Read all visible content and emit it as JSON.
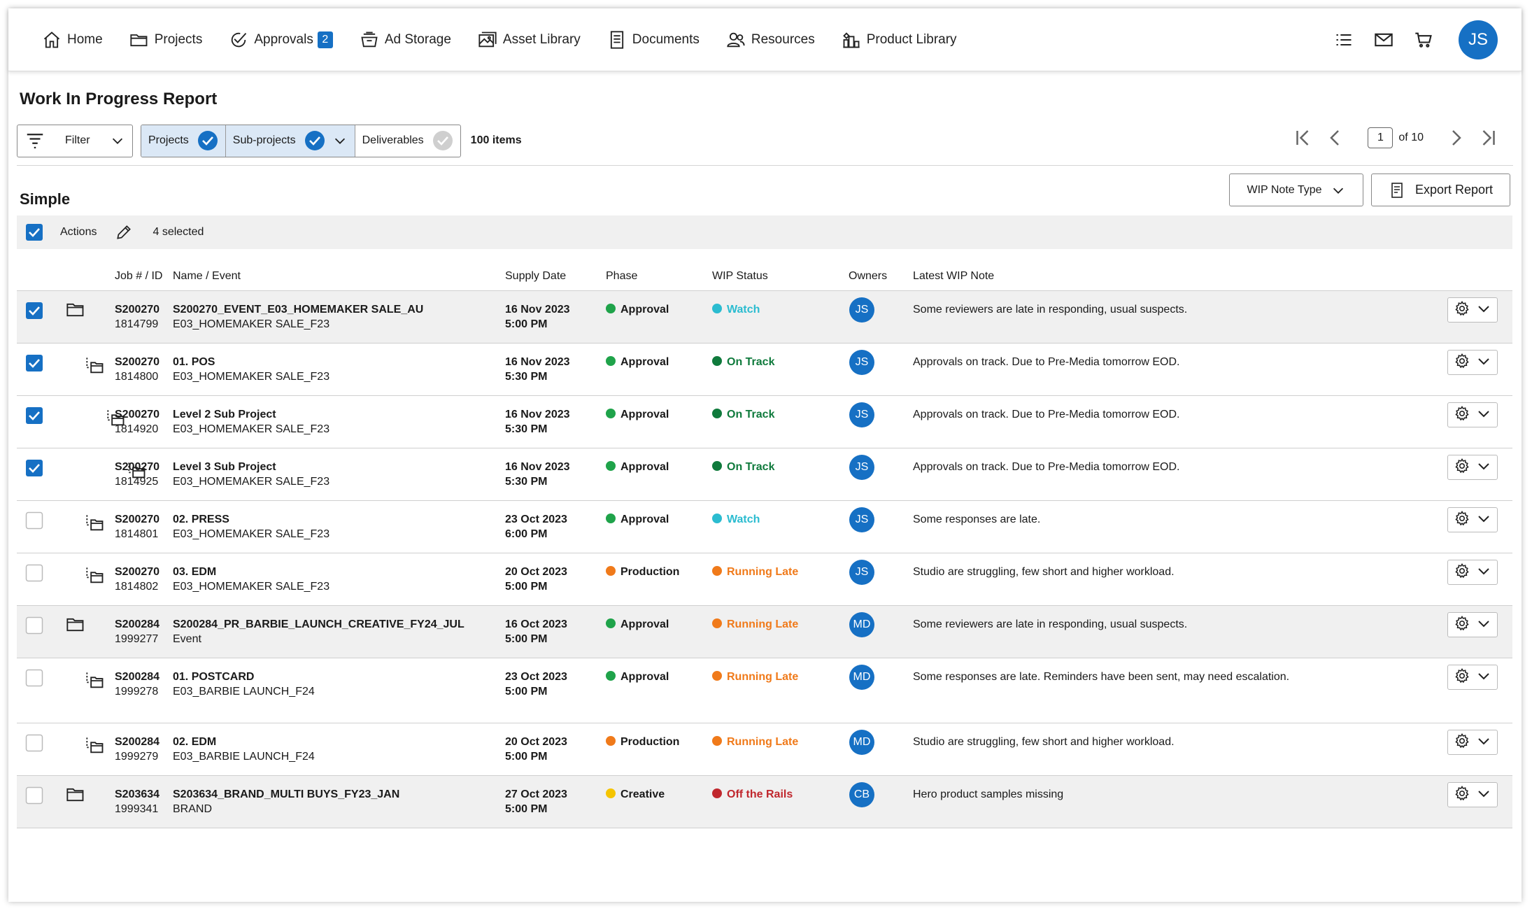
{
  "nav": {
    "items": [
      {
        "label": "Home",
        "icon": "home-icon"
      },
      {
        "label": "Projects",
        "icon": "folder-icon"
      },
      {
        "label": "Approvals",
        "icon": "approval-check-icon",
        "badge": "2"
      },
      {
        "label": "Ad Storage",
        "icon": "storage-basket-icon"
      },
      {
        "label": "Asset Library",
        "icon": "image-library-icon"
      },
      {
        "label": "Documents",
        "icon": "document-icon"
      },
      {
        "label": "Resources",
        "icon": "people-icon"
      },
      {
        "label": "Product Library",
        "icon": "product-library-icon"
      }
    ],
    "avatar": "JS"
  },
  "page": {
    "title": "Work In Progress Report"
  },
  "filterbar": {
    "filter_label": "Filter",
    "segments": [
      {
        "label": "Projects",
        "checked": true
      },
      {
        "label": "Sub-projects",
        "checked": true
      },
      {
        "label": "Deliverables",
        "checked": false
      }
    ],
    "items_count": "100 items"
  },
  "pager": {
    "current": "1",
    "of_label": "of 10"
  },
  "section": {
    "title": "Simple",
    "wip_note_type": "WIP Note Type",
    "export_report": "Export Report"
  },
  "actions": {
    "label": "Actions",
    "selected": "4 selected"
  },
  "table": {
    "headers": {
      "job": "Job # / ID",
      "name": "Name / Event",
      "supply": "Supply Date",
      "phase": "Phase",
      "wip": "WIP Status",
      "owners": "Owners",
      "note": "Latest WIP Note"
    },
    "rows": [
      {
        "checked": true,
        "level": 0,
        "job": "S200270",
        "id": "1814799",
        "name": "S200270_EVENT_E03_HOMEMAKER SALE_AU",
        "event": "E03_HOMEMAKER SALE_F23",
        "date": "16 Nov 2023",
        "time": "5:00 PM",
        "phase": "Approval",
        "phase_color": "#1fa34a",
        "status": "Watch",
        "status_color": "#2bbcd0",
        "owner": "JS",
        "note": "Some reviewers are late in responding, usual suspects."
      },
      {
        "checked": true,
        "level": 1,
        "job": "S200270",
        "id": "1814800",
        "name": "01. POS",
        "event": "E03_HOMEMAKER SALE_F23",
        "date": "16 Nov 2023",
        "time": "5:30 PM",
        "phase": "Approval",
        "phase_color": "#1fa34a",
        "status": "On Track",
        "status_color": "#0f7a3c",
        "owner": "JS",
        "note": "Approvals on track. Due to Pre-Media tomorrow EOD."
      },
      {
        "checked": true,
        "level": 2,
        "job": "S200270",
        "id": "1814920",
        "name": "Level 2 Sub Project",
        "event": "E03_HOMEMAKER SALE_F23",
        "date": "16 Nov 2023",
        "time": "5:30 PM",
        "phase": "Approval",
        "phase_color": "#1fa34a",
        "status": "On Track",
        "status_color": "#0f7a3c",
        "owner": "JS",
        "note": "Approvals on track. Due to Pre-Media tomorrow EOD."
      },
      {
        "checked": true,
        "level": 3,
        "job": "S200270",
        "id": "1814925",
        "name": "Level 3 Sub Project",
        "event": "E03_HOMEMAKER SALE_F23",
        "date": "16 Nov 2023",
        "time": "5:30 PM",
        "phase": "Approval",
        "phase_color": "#1fa34a",
        "status": "On Track",
        "status_color": "#0f7a3c",
        "owner": "JS",
        "note": "Approvals on track. Due to Pre-Media tomorrow EOD."
      },
      {
        "checked": false,
        "level": 1,
        "job": "S200270",
        "id": "1814801",
        "name": "02. PRESS",
        "event": "E03_HOMEMAKER SALE_F23",
        "date": "23 Oct 2023",
        "time": "6:00 PM",
        "phase": "Approval",
        "phase_color": "#1fa34a",
        "status": "Watch",
        "status_color": "#2bbcd0",
        "owner": "JS",
        "note": "Some responses are late."
      },
      {
        "checked": false,
        "level": 1,
        "job": "S200270",
        "id": "1814802",
        "name": "03. EDM",
        "event": "E03_HOMEMAKER SALE_F23",
        "date": "20 Oct 2023",
        "time": "5:00 PM",
        "phase": "Production",
        "phase_color": "#f07a1a",
        "status": "Running Late",
        "status_color": "#f07a1a",
        "owner": "JS",
        "note": "Studio are struggling, few short and higher workload."
      },
      {
        "checked": false,
        "level": 0,
        "job": "S200284",
        "id": "1999277",
        "name": "S200284_PR_BARBIE_LAUNCH_CREATIVE_FY24_JUL",
        "event": "Event",
        "date": "16 Oct 2023",
        "time": "5:00 PM",
        "phase": "Approval",
        "phase_color": "#1fa34a",
        "status": "Running Late",
        "status_color": "#f07a1a",
        "owner": "MD",
        "note": "Some reviewers are late in responding, usual suspects."
      },
      {
        "checked": false,
        "level": 1,
        "job": "S200284",
        "id": "1999278",
        "name": "01. POSTCARD",
        "event": "E03_BARBIE LAUNCH_F24",
        "date": "23 Oct 2023",
        "time": "5:00 PM",
        "phase": "Approval",
        "phase_color": "#1fa34a",
        "status": "Running Late",
        "status_color": "#f07a1a",
        "owner": "MD",
        "note": "Some responses are late. Reminders have been sent, may need escalation."
      },
      {
        "checked": false,
        "level": 1,
        "job": "S200284",
        "id": "1999279",
        "name": "02. EDM",
        "event": "E03_BARBIE LAUNCH_F24",
        "date": "20 Oct 2023",
        "time": "5:00 PM",
        "phase": "Production",
        "phase_color": "#f07a1a",
        "status": "Running Late",
        "status_color": "#f07a1a",
        "owner": "MD",
        "note": "Studio are struggling, few short and higher workload."
      },
      {
        "checked": false,
        "level": 0,
        "job": "S203634",
        "id": "1999341",
        "name": "S203634_BRAND_MULTI BUYS_FY23_JAN",
        "event": "BRAND",
        "date": "27 Oct 2023",
        "time": "5:00 PM",
        "phase": "Creative",
        "phase_color": "#f5c400",
        "status": "Off the Rails",
        "status_color": "#c0272d",
        "owner": "CB",
        "note": "Hero product samples missing"
      }
    ]
  }
}
